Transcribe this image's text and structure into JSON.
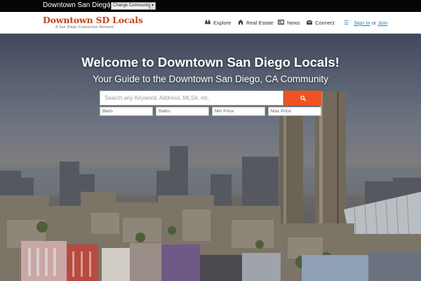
{
  "topbar": {
    "location": "Downtown San Diego, CA",
    "separator": "|",
    "change_label": "Change Community"
  },
  "header": {
    "logo_name": "Downtown SD Locals",
    "logo_tagline": "A San Diego Connection Network",
    "nav": [
      {
        "label": "Explore",
        "icon": "binoculars-icon"
      },
      {
        "label": "Real Estate",
        "icon": "home-icon"
      },
      {
        "label": "News",
        "icon": "newspaper-icon"
      },
      {
        "label": "Connect",
        "icon": "envelope-icon"
      }
    ],
    "sign_in": "Sign In",
    "or_text": "or",
    "join": "Join"
  },
  "hero": {
    "title": "Welcome to Downtown San Diego Locals!",
    "subtitle": "Your Guide to the Downtown San Diego, CA Community"
  },
  "search": {
    "placeholder": "Search any Keyword, Address, MLS#, etc.",
    "button_icon": "search-icon",
    "filters": {
      "beds": "Beds",
      "baths": "Baths",
      "min_price": "Min Price",
      "max_price": "Max Price"
    }
  },
  "colors": {
    "accent": "#ee5423",
    "brand": "#c5451d",
    "link": "#2a7fb8"
  }
}
